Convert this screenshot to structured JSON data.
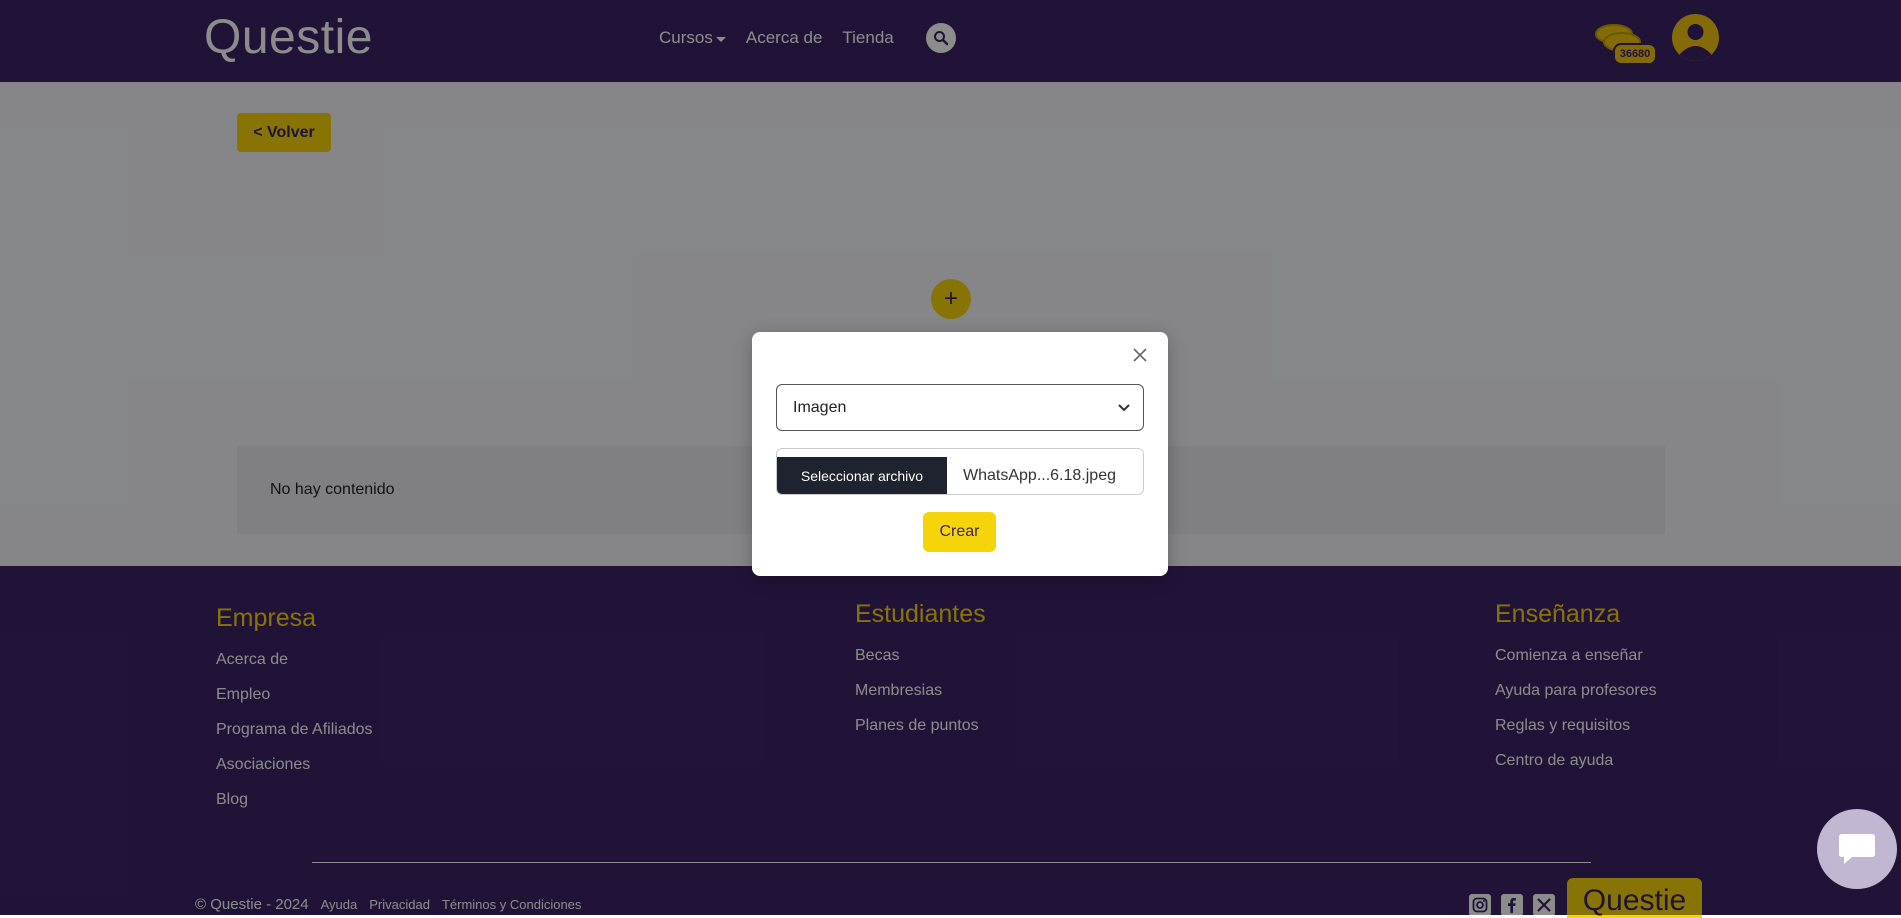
{
  "header": {
    "logo": "Questie",
    "nav": [
      {
        "label": "Cursos"
      },
      {
        "label": "Acerca de"
      },
      {
        "label": "Tienda"
      }
    ],
    "coins": "36680"
  },
  "main": {
    "back_label": "< Volver",
    "add_label": "+",
    "empty_text": "No hay contenido"
  },
  "footer": {
    "columns": [
      {
        "title": "Empresa",
        "links": [
          "Acerca de",
          "Empleo",
          "Programa de Afiliados",
          "Asociaciones",
          "Blog"
        ]
      },
      {
        "title": "Estudiantes",
        "links": [
          "Becas",
          "Membresias",
          "Planes de puntos"
        ]
      },
      {
        "title": "Enseñanza",
        "links": [
          "Comienza a enseñar",
          "Ayuda para profesores",
          "Reglas y requisitos",
          "Centro de ayuda"
        ]
      }
    ],
    "copyright": "© Questie - 2024",
    "bottom_links": [
      "Ayuda",
      "Privacidad",
      "Términos y Condiciones"
    ],
    "logo": "Questie"
  },
  "modal": {
    "select_value": "Imagen",
    "file_button": "Seleccionar archivo",
    "file_name": "WhatsApp...6.18.jpeg",
    "create_label": "Crear"
  },
  "colors": {
    "brand_purple": "#3d2466",
    "brand_yellow": "#f6d40a"
  }
}
